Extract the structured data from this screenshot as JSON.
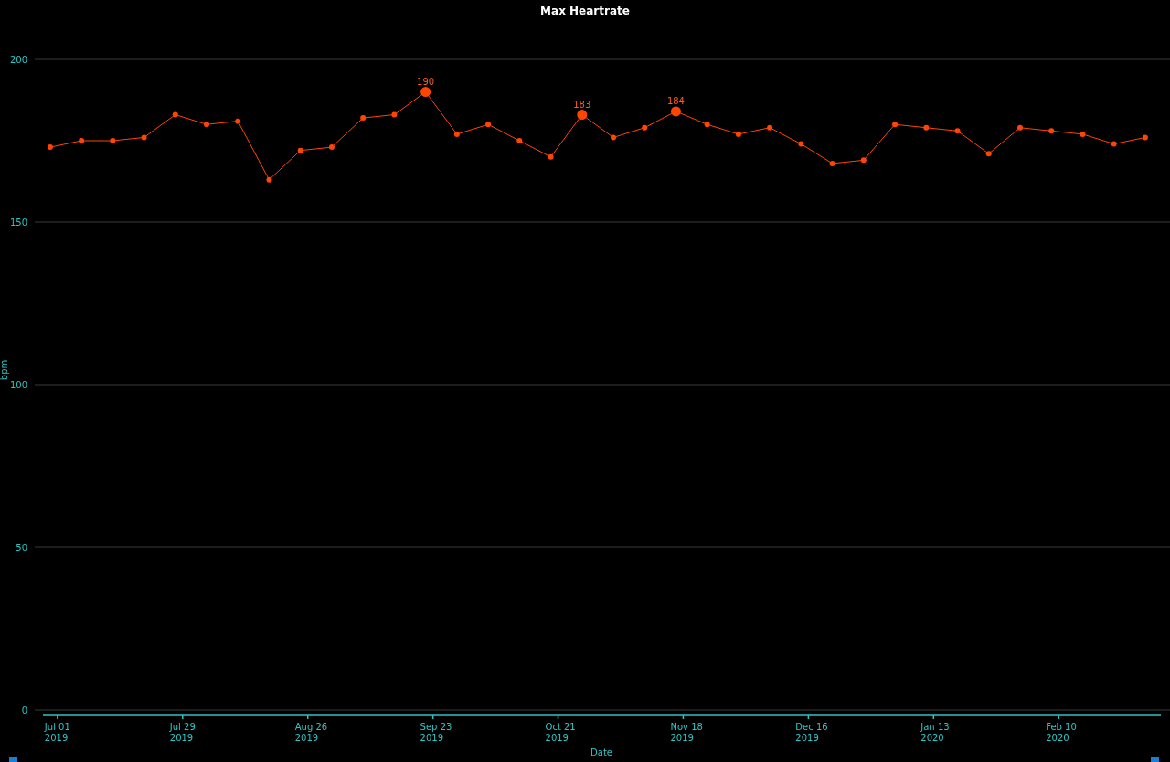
{
  "chart": {
    "chart_data": {
      "type": "line",
      "title": "Max Heartrate",
      "xlabel": "Date",
      "ylabel": "bpm",
      "categories": [
        "Jul 01 2019",
        null,
        null,
        null,
        "Jul 29 2019",
        null,
        null,
        null,
        "Aug 26 2019",
        null,
        null,
        null,
        "Sep 23 2019",
        null,
        null,
        null,
        "Oct 21 2019",
        null,
        null,
        null,
        "Nov 18 2019",
        null,
        null,
        null,
        "Dec 16 2019",
        null,
        null,
        null,
        "Jan 13 2020",
        null,
        null,
        null,
        "Feb 10 2020",
        null,
        null,
        null
      ],
      "series": [
        {
          "color": "#ff4500",
          "marker": "circle",
          "values": [
            173,
            175,
            175,
            176,
            183,
            180,
            181,
            163,
            172,
            173,
            182,
            183,
            190,
            177,
            180,
            175,
            170,
            183,
            176,
            179,
            184,
            180,
            177,
            179,
            174,
            168,
            169,
            180,
            179,
            178,
            171,
            179,
            178,
            177,
            174,
            176
          ]
        }
      ],
      "ylim": [
        0,
        200
      ],
      "yticks": [
        0,
        50,
        100,
        150,
        200
      ],
      "grid": true,
      "value_labels": [
        null,
        null,
        null,
        null,
        null,
        null,
        null,
        null,
        null,
        null,
        null,
        null,
        "190",
        null,
        null,
        null,
        null,
        "183",
        null,
        null,
        "184",
        null,
        null,
        null,
        null,
        null,
        null,
        null,
        null,
        null,
        null,
        null,
        null,
        null,
        null,
        null
      ]
    }
  }
}
